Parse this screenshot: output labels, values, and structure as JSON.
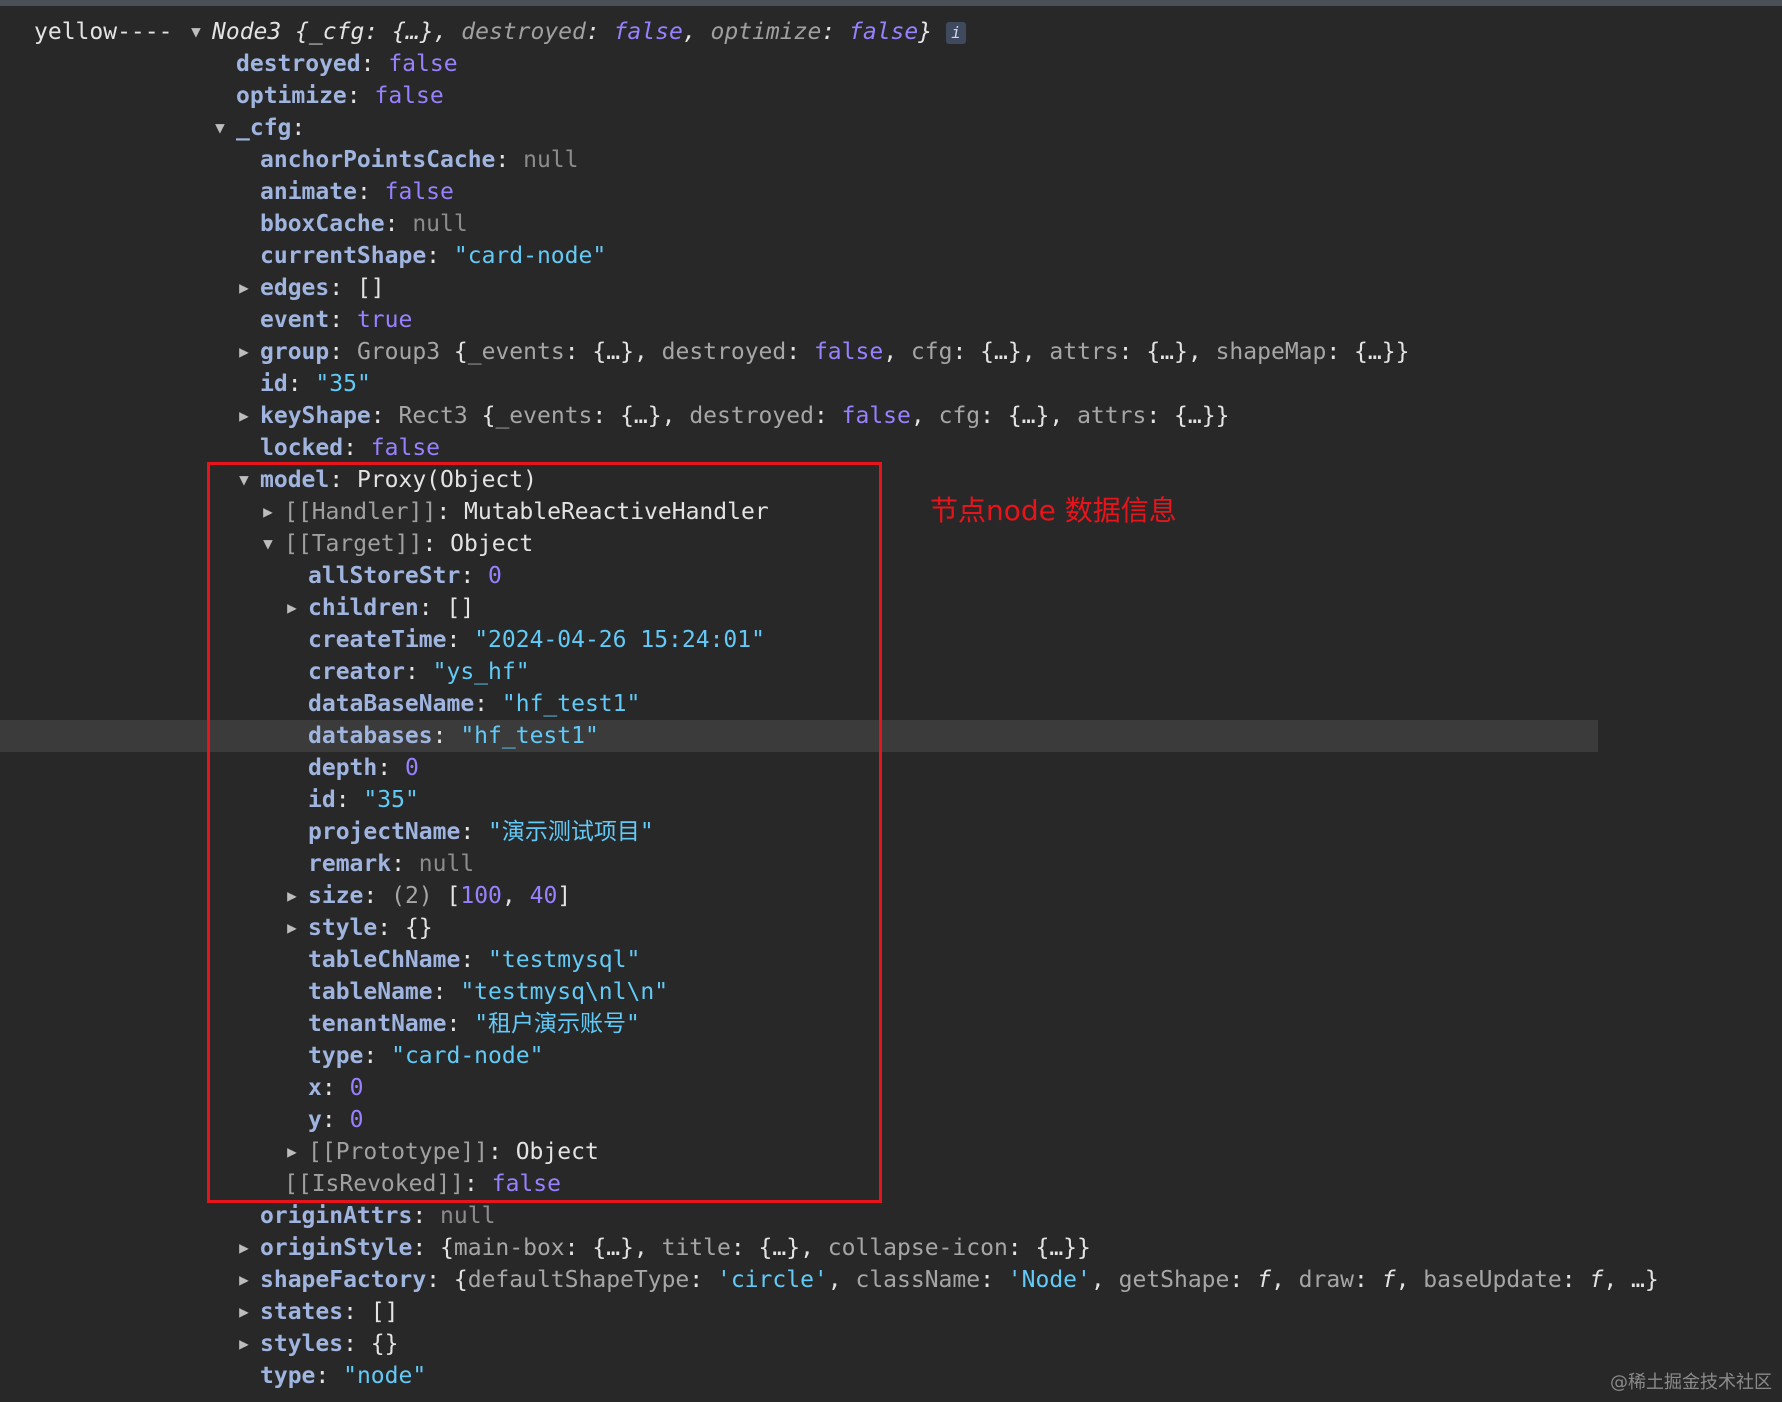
{
  "prefix": "yellow----",
  "annotation": "节点node 数据信息",
  "watermark": "@稀土掘金技术社区",
  "colors": {
    "key": "#9fb4df",
    "string": "#62caf6",
    "boolean": "#9980ff",
    "null": "#8c8c8c",
    "highlight": "#e8141c"
  },
  "rows": [
    {
      "tri": "expanded",
      "segs": [
        [
          "p it",
          "Node3 {_cfg: {…}, "
        ],
        [
          "ik it",
          "destroyed"
        ],
        [
          "p it",
          ": "
        ],
        [
          "b it",
          "false"
        ],
        [
          "p it",
          ", "
        ],
        [
          "ik it",
          "optimize"
        ],
        [
          "p it",
          ": "
        ],
        [
          "b it",
          "false"
        ],
        [
          "p it",
          "}"
        ]
      ],
      "info": "i"
    },
    {
      "segs": [
        [
          "k",
          "destroyed"
        ],
        [
          "p",
          ": "
        ],
        [
          "b",
          "false"
        ]
      ]
    },
    {
      "segs": [
        [
          "k",
          "optimize"
        ],
        [
          "p",
          ": "
        ],
        [
          "b",
          "false"
        ]
      ]
    },
    {
      "tri": "expanded",
      "segs": [
        [
          "k",
          "_cfg"
        ],
        [
          "p",
          ":"
        ]
      ]
    },
    {
      "segs": [
        [
          "k",
          "anchorPointsCache"
        ],
        [
          "p",
          ": "
        ],
        [
          "nul",
          "null"
        ]
      ]
    },
    {
      "segs": [
        [
          "k",
          "animate"
        ],
        [
          "p",
          ": "
        ],
        [
          "b",
          "false"
        ]
      ]
    },
    {
      "segs": [
        [
          "k",
          "bboxCache"
        ],
        [
          "p",
          ": "
        ],
        [
          "nul",
          "null"
        ]
      ]
    },
    {
      "segs": [
        [
          "k",
          "currentShape"
        ],
        [
          "p",
          ": "
        ],
        [
          "s",
          "\"card-node\""
        ]
      ]
    },
    {
      "tri": "collapsed",
      "segs": [
        [
          "k",
          "edges"
        ],
        [
          "p",
          ": []"
        ]
      ]
    },
    {
      "segs": [
        [
          "k",
          "event"
        ],
        [
          "p",
          ": "
        ],
        [
          "b",
          "true"
        ]
      ]
    },
    {
      "tri": "collapsed",
      "segs": [
        [
          "k",
          "group"
        ],
        [
          "p",
          ": "
        ],
        [
          "cls",
          "Group3 "
        ],
        [
          "p",
          "{"
        ],
        [
          "cls",
          "_events"
        ],
        [
          "p",
          ": {…}, "
        ],
        [
          "cls",
          "destroyed"
        ],
        [
          "p",
          ": "
        ],
        [
          "b",
          "false"
        ],
        [
          "p",
          ", "
        ],
        [
          "cls",
          "cfg"
        ],
        [
          "p",
          ": {…}, "
        ],
        [
          "cls",
          "attrs"
        ],
        [
          "p",
          ": {…}, "
        ],
        [
          "cls",
          "shapeMap"
        ],
        [
          "p",
          ": {…}}"
        ]
      ]
    },
    {
      "segs": [
        [
          "k",
          "id"
        ],
        [
          "p",
          ": "
        ],
        [
          "s",
          "\"35\""
        ]
      ]
    },
    {
      "tri": "collapsed",
      "segs": [
        [
          "k",
          "keyShape"
        ],
        [
          "p",
          ": "
        ],
        [
          "cls",
          "Rect3 "
        ],
        [
          "p",
          "{"
        ],
        [
          "cls",
          "_events"
        ],
        [
          "p",
          ": {…}, "
        ],
        [
          "cls",
          "destroyed"
        ],
        [
          "p",
          ": "
        ],
        [
          "b",
          "false"
        ],
        [
          "p",
          ", "
        ],
        [
          "cls",
          "cfg"
        ],
        [
          "p",
          ": {…}, "
        ],
        [
          "cls",
          "attrs"
        ],
        [
          "p",
          ": {…}}"
        ]
      ]
    },
    {
      "segs": [
        [
          "k",
          "locked"
        ],
        [
          "p",
          ": "
        ],
        [
          "b",
          "false"
        ]
      ]
    },
    {
      "tri": "expanded",
      "segs": [
        [
          "k",
          "model"
        ],
        [
          "p",
          ": Proxy(Object)"
        ]
      ]
    },
    {
      "tri": "collapsed",
      "segs": [
        [
          "ik",
          "[[Handler]]"
        ],
        [
          "p",
          ": MutableReactiveHandler"
        ]
      ]
    },
    {
      "tri": "expanded",
      "segs": [
        [
          "ik",
          "[[Target]]"
        ],
        [
          "p",
          ": Object"
        ]
      ]
    },
    {
      "segs": [
        [
          "k",
          "allStoreStr"
        ],
        [
          "p",
          ": "
        ],
        [
          "n",
          "0"
        ]
      ]
    },
    {
      "tri": "collapsed",
      "segs": [
        [
          "k",
          "children"
        ],
        [
          "p",
          ": []"
        ]
      ]
    },
    {
      "segs": [
        [
          "k",
          "createTime"
        ],
        [
          "p",
          ": "
        ],
        [
          "s",
          "\"2024-04-26 15:24:01\""
        ]
      ]
    },
    {
      "segs": [
        [
          "k",
          "creator"
        ],
        [
          "p",
          ": "
        ],
        [
          "s",
          "\"ys_hf\""
        ]
      ]
    },
    {
      "segs": [
        [
          "k",
          "dataBaseName"
        ],
        [
          "p",
          ": "
        ],
        [
          "s",
          "\"hf_test1\""
        ]
      ]
    },
    {
      "segs": [
        [
          "k",
          "databases"
        ],
        [
          "p",
          ": "
        ],
        [
          "s",
          "\"hf_test1\""
        ]
      ]
    },
    {
      "segs": [
        [
          "k",
          "depth"
        ],
        [
          "p",
          ": "
        ],
        [
          "n",
          "0"
        ]
      ]
    },
    {
      "segs": [
        [
          "k",
          "id"
        ],
        [
          "p",
          ": "
        ],
        [
          "s",
          "\"35\""
        ]
      ]
    },
    {
      "segs": [
        [
          "k",
          "projectName"
        ],
        [
          "p",
          ": "
        ],
        [
          "s",
          "\"演示测试项目\""
        ]
      ]
    },
    {
      "segs": [
        [
          "k",
          "remark"
        ],
        [
          "p",
          ": "
        ],
        [
          "nul",
          "null"
        ]
      ]
    },
    {
      "tri": "collapsed",
      "segs": [
        [
          "k",
          "size"
        ],
        [
          "p",
          ": "
        ],
        [
          "cls",
          "(2) "
        ],
        [
          "p",
          "["
        ],
        [
          "n",
          "100"
        ],
        [
          "p",
          ", "
        ],
        [
          "n",
          "40"
        ],
        [
          "p",
          "]"
        ]
      ]
    },
    {
      "tri": "collapsed",
      "segs": [
        [
          "k",
          "style"
        ],
        [
          "p",
          ": {}"
        ]
      ]
    },
    {
      "segs": [
        [
          "k",
          "tableChName"
        ],
        [
          "p",
          ": "
        ],
        [
          "s",
          "\"testmysql\""
        ]
      ]
    },
    {
      "segs": [
        [
          "k",
          "tableName"
        ],
        [
          "p",
          ": "
        ],
        [
          "s",
          "\"testmysq\\nl\\n\""
        ]
      ]
    },
    {
      "segs": [
        [
          "k",
          "tenantName"
        ],
        [
          "p",
          ": "
        ],
        [
          "s",
          "\"租户演示账号\""
        ]
      ]
    },
    {
      "segs": [
        [
          "k",
          "type"
        ],
        [
          "p",
          ": "
        ],
        [
          "s",
          "\"card-node\""
        ]
      ]
    },
    {
      "segs": [
        [
          "k",
          "x"
        ],
        [
          "p",
          ": "
        ],
        [
          "n",
          "0"
        ]
      ]
    },
    {
      "segs": [
        [
          "k",
          "y"
        ],
        [
          "p",
          ": "
        ],
        [
          "n",
          "0"
        ]
      ]
    },
    {
      "tri": "collapsed",
      "segs": [
        [
          "ik",
          "[[Prototype]]"
        ],
        [
          "p",
          ": Object"
        ]
      ]
    },
    {
      "segs": [
        [
          "ik",
          "[[IsRevoked]]"
        ],
        [
          "p",
          ": "
        ],
        [
          "b",
          "false"
        ]
      ]
    },
    {
      "segs": [
        [
          "k",
          "originAttrs"
        ],
        [
          "p",
          ": "
        ],
        [
          "nul",
          "null"
        ]
      ]
    },
    {
      "tri": "collapsed",
      "segs": [
        [
          "k",
          "originStyle"
        ],
        [
          "p",
          ": {"
        ],
        [
          "cls",
          "main-box"
        ],
        [
          "p",
          ": {…}, "
        ],
        [
          "cls",
          "title"
        ],
        [
          "p",
          ": {…}, "
        ],
        [
          "cls",
          "collapse-icon"
        ],
        [
          "p",
          ": {…}}"
        ]
      ]
    },
    {
      "tri": "collapsed",
      "segs": [
        [
          "k",
          "shapeFactory"
        ],
        [
          "p",
          ": {"
        ],
        [
          "cls",
          "defaultShapeType"
        ],
        [
          "p",
          ": "
        ],
        [
          "s",
          "'circle'"
        ],
        [
          "p",
          ", "
        ],
        [
          "cls",
          "className"
        ],
        [
          "p",
          ": "
        ],
        [
          "s",
          "'Node'"
        ],
        [
          "p",
          ", "
        ],
        [
          "cls",
          "getShape"
        ],
        [
          "p",
          ": "
        ],
        [
          "p it",
          "f"
        ],
        [
          "p",
          ", "
        ],
        [
          "cls",
          "draw"
        ],
        [
          "p",
          ": "
        ],
        [
          "p it",
          "f"
        ],
        [
          "p",
          ", "
        ],
        [
          "cls",
          "baseUpdate"
        ],
        [
          "p",
          ": "
        ],
        [
          "p it",
          "f"
        ],
        [
          "p",
          ", …}"
        ]
      ]
    },
    {
      "tri": "collapsed",
      "segs": [
        [
          "k",
          "states"
        ],
        [
          "p",
          ": []"
        ]
      ]
    },
    {
      "tri": "collapsed",
      "segs": [
        [
          "k",
          "styles"
        ],
        [
          "p",
          ": {}"
        ]
      ]
    },
    {
      "segs": [
        [
          "k",
          "type"
        ],
        [
          "p",
          ": "
        ],
        [
          "s",
          "\"node\""
        ]
      ]
    }
  ]
}
